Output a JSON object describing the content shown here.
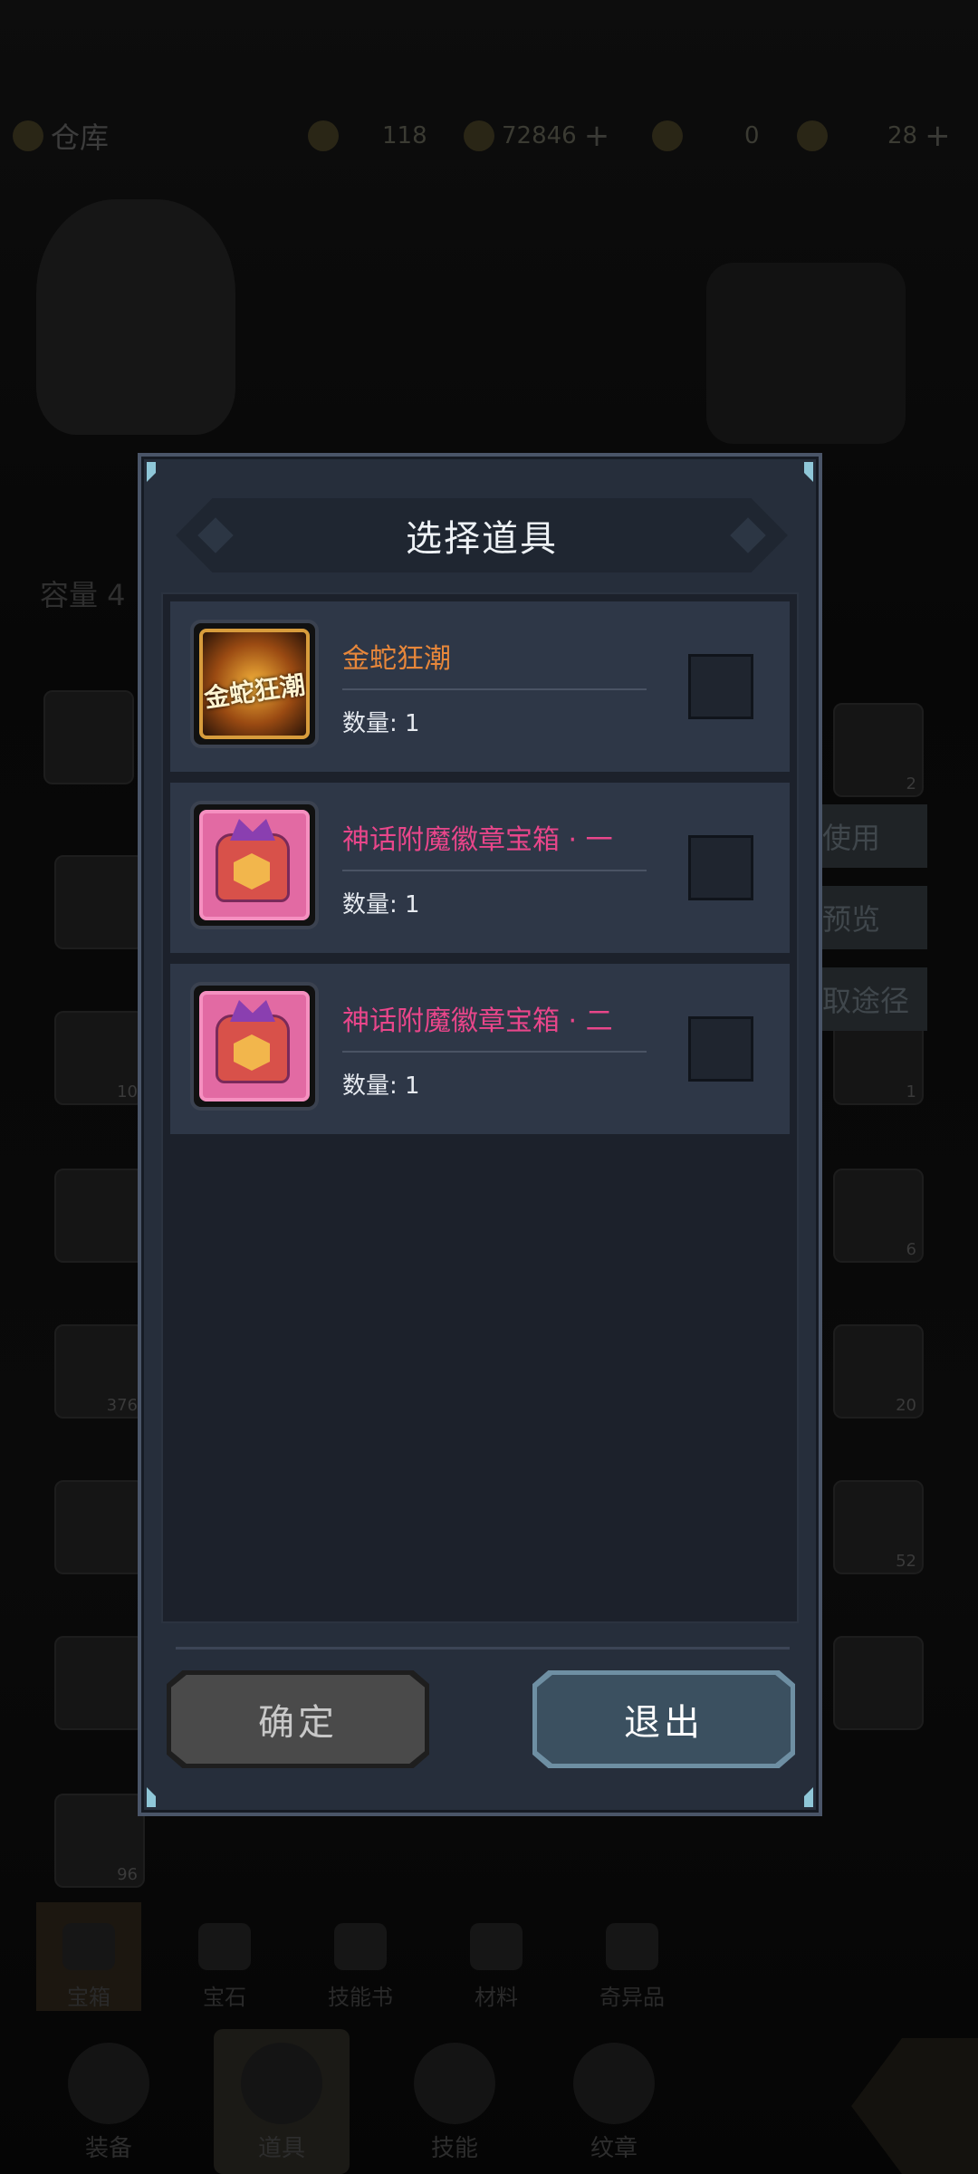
{
  "background": {
    "title": "仓库",
    "stats": [
      {
        "icon": "token-icon",
        "value": "118"
      },
      {
        "icon": "gold-icon",
        "value": "72846"
      },
      {
        "icon": "crystal-icon",
        "value": "0"
      },
      {
        "icon": "stamina-icon",
        "value": "28"
      }
    ],
    "capacity_label": "容量 4",
    "side_buttons": [
      "使用",
      "预览",
      "取途径"
    ],
    "grid_counts": [
      "2",
      "10",
      "1",
      "6",
      "376",
      "20",
      "52",
      "96"
    ],
    "category_tabs": [
      "宝箱",
      "宝石",
      "技能书",
      "材料",
      "奇异品"
    ],
    "bottom_nav": [
      "装备",
      "道具",
      "技能",
      "纹章"
    ]
  },
  "dialog": {
    "title": "选择道具",
    "items": [
      {
        "name": "金蛇狂潮",
        "quantity_label": "数量: 1",
        "name_color": "#e8873a",
        "thumb_text": "金蛇狂潮",
        "thumb_style": "gold",
        "checked": false
      },
      {
        "name": "神话附魔徽章宝箱 · 一",
        "quantity_label": "数量: 1",
        "name_color": "#e8468a",
        "thumb_style": "pink",
        "checked": false
      },
      {
        "name": "神话附魔徽章宝箱 · 二",
        "quantity_label": "数量: 1",
        "name_color": "#e8468a",
        "thumb_style": "pink",
        "checked": false
      }
    ],
    "confirm_label": "确定",
    "exit_label": "退出"
  }
}
